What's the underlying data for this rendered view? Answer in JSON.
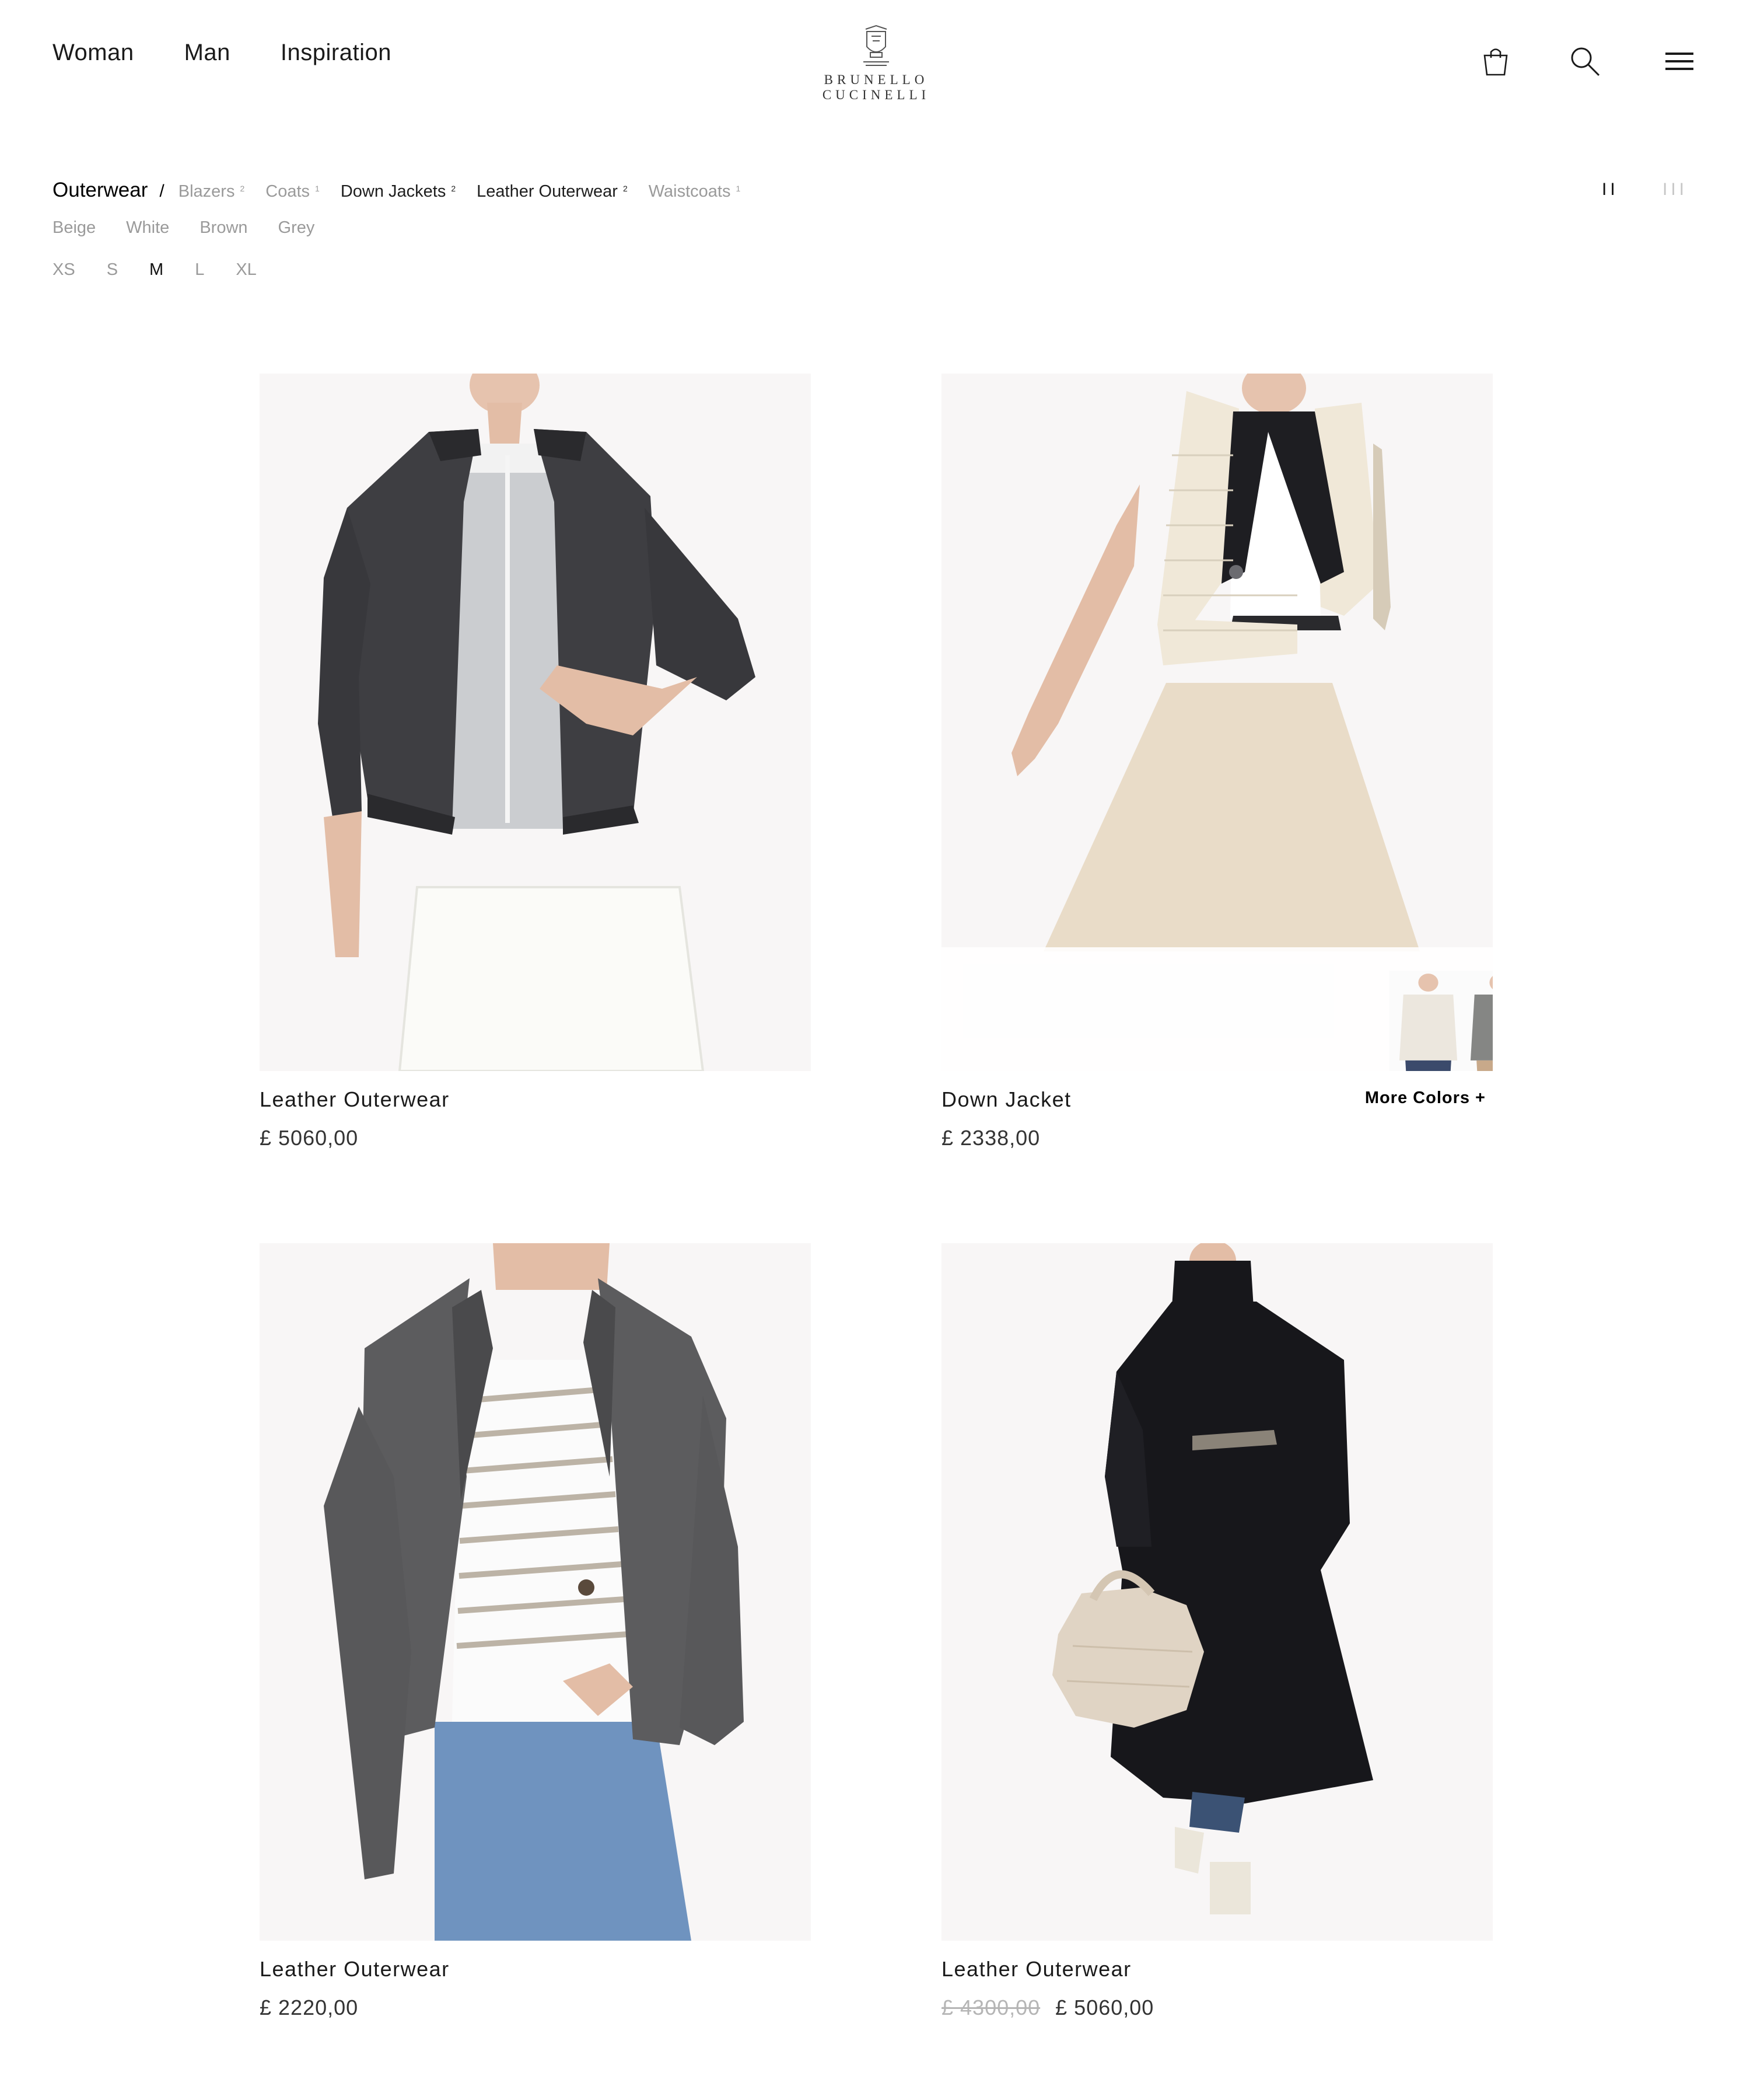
{
  "nav": {
    "woman": "Woman",
    "man": "Man",
    "inspiration": "Inspiration"
  },
  "brand": "BRUNELLO CUCINELLI",
  "header_icons": [
    "shopping-bag-icon",
    "search-icon",
    "menu-icon"
  ],
  "filters": {
    "breadcrumb": "Outerwear",
    "separator": "/",
    "categories": [
      {
        "label": "Blazers",
        "count": "2"
      },
      {
        "label": "Coats",
        "count": "1"
      },
      {
        "label": "Down Jackets",
        "count": "2"
      },
      {
        "label": "Leather Outerwear",
        "count": "2"
      },
      {
        "label": "Waistcoats",
        "count": "1"
      }
    ],
    "colors": [
      "Beige",
      "White",
      "Brown",
      "Grey"
    ],
    "sizes": [
      "XS",
      "S",
      "M",
      "L",
      "XL"
    ],
    "active_size": "M"
  },
  "grid_view": {
    "two": "II",
    "three": "III"
  },
  "products": [
    {
      "name": "Leather Outerwear",
      "price": "£ 5060,00"
    },
    {
      "name": "Down Jacket",
      "price": "£ 2338,00",
      "more_colors": "More Colors +"
    },
    {
      "name": "Leather Outerwear",
      "price": "£ 2220,00"
    },
    {
      "name": "Leather Outerwear",
      "old_price": "£ 4300,00",
      "price": "£ 5060,00"
    }
  ]
}
